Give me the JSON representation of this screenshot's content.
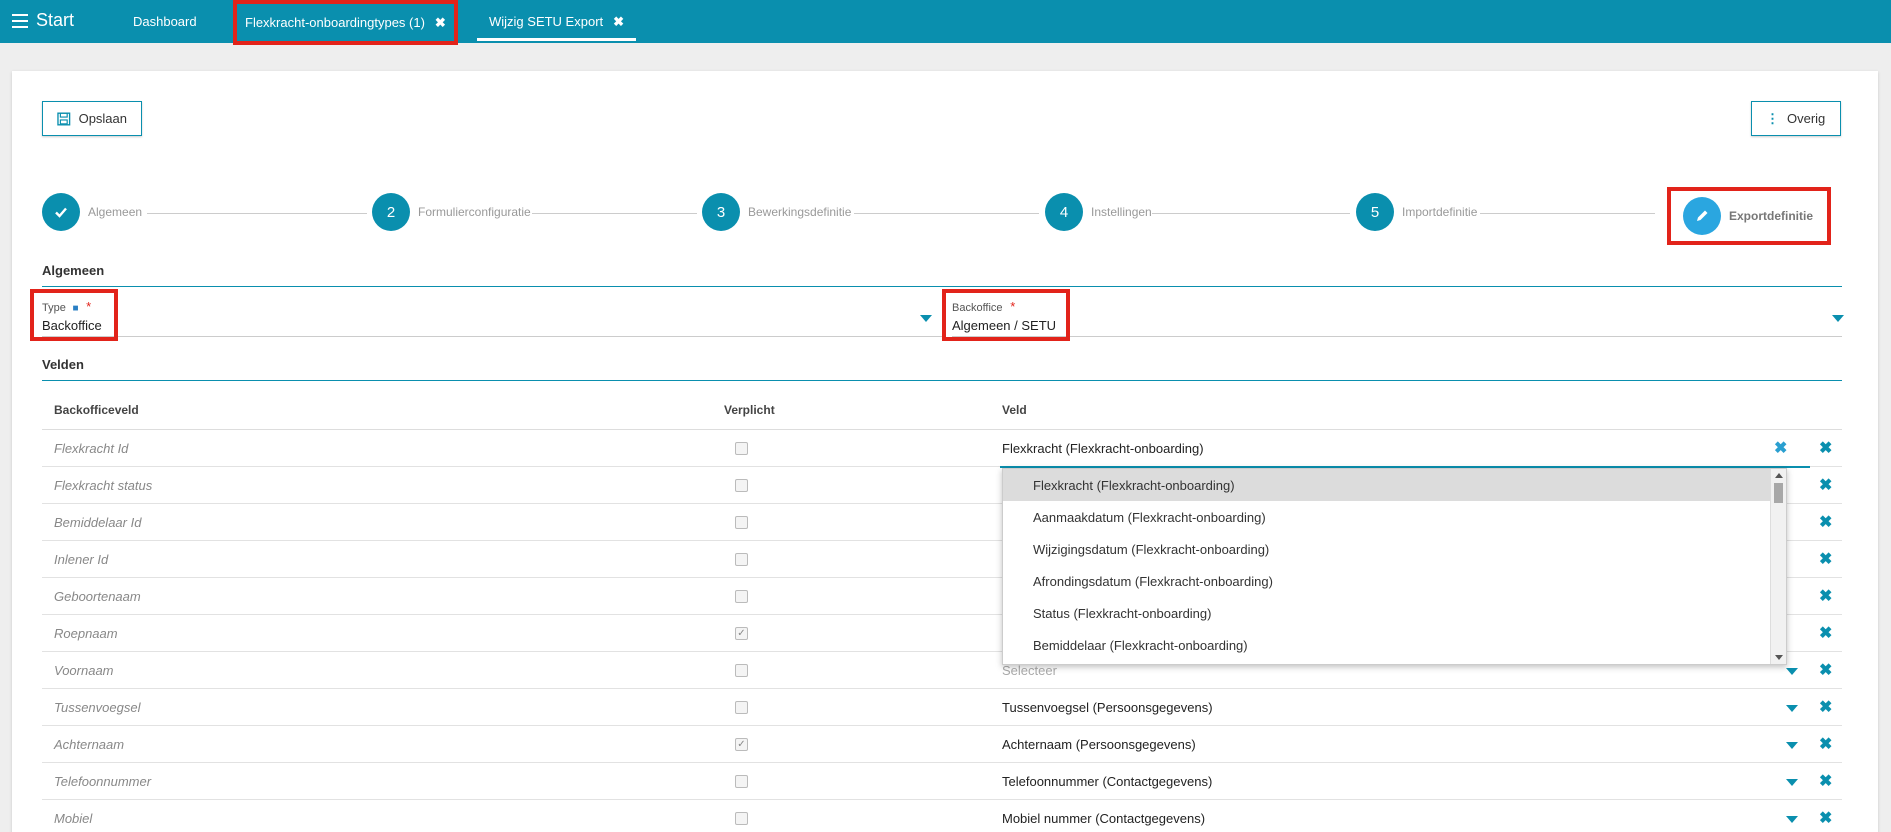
{
  "topbar": {
    "start": "Start",
    "tabs": [
      {
        "label": "Dashboard"
      },
      {
        "label": "Flexkracht-onboardingtypes (1)"
      },
      {
        "label": "Wijzig SETU Export"
      }
    ]
  },
  "toolbar": {
    "save": "Opslaan",
    "more": "Overig"
  },
  "steps": [
    {
      "num": "",
      "label": "Algemeen",
      "done": true
    },
    {
      "num": "2",
      "label": "Formulierconfiguratie"
    },
    {
      "num": "3",
      "label": "Bewerkingsdefinitie"
    },
    {
      "num": "4",
      "label": "Instellingen"
    },
    {
      "num": "5",
      "label": "Importdefinitie"
    },
    {
      "num": "",
      "label": "Exportdefinitie",
      "active": true
    }
  ],
  "sections": {
    "algemeen": "Algemeen",
    "velden": "Velden"
  },
  "type_field": {
    "label": "Type",
    "required": "*",
    "value": "Backoffice"
  },
  "backoffice_field": {
    "label": "Backoffice",
    "required": "*",
    "value": "Algemeen / SETU"
  },
  "table": {
    "headers": [
      "Backofficeveld",
      "Verplicht",
      "Veld"
    ],
    "rows": [
      {
        "bo": "Flexkracht Id",
        "checked": false,
        "veld": "Flexkracht (Flexkracht-onboarding)"
      },
      {
        "bo": "Flexkracht status",
        "checked": false,
        "veld": ""
      },
      {
        "bo": "Bemiddelaar Id",
        "checked": false,
        "veld": ""
      },
      {
        "bo": "Inlener Id",
        "checked": false,
        "veld": ""
      },
      {
        "bo": "Geboortenaam",
        "checked": false,
        "veld": ""
      },
      {
        "bo": "Roepnaam",
        "checked": true,
        "veld": ""
      },
      {
        "bo": "Voornaam",
        "checked": false,
        "veld": "Selecteer"
      },
      {
        "bo": "Tussenvoegsel",
        "checked": false,
        "veld": "Tussenvoegsel (Persoonsgegevens)"
      },
      {
        "bo": "Achternaam",
        "checked": true,
        "veld": "Achternaam (Persoonsgegevens)"
      },
      {
        "bo": "Telefoonnummer",
        "checked": false,
        "veld": "Telefoonnummer (Contactgegevens)"
      },
      {
        "bo": "Mobiel",
        "checked": false,
        "veld": "Mobiel nummer (Contactgegevens)"
      }
    ]
  },
  "dropdown": {
    "options": [
      "Flexkracht (Flexkracht-onboarding)",
      "Aanmaakdatum (Flexkracht-onboarding)",
      "Wijzigingsdatum (Flexkracht-onboarding)",
      "Afrondingsdatum (Flexkracht-onboarding)",
      "Status (Flexkracht-onboarding)",
      "Bemiddelaar (Flexkracht-onboarding)"
    ]
  },
  "colors": {
    "accent": "#0a8fae",
    "highlight": "#e2231a",
    "active_step": "#2aa6e0"
  }
}
